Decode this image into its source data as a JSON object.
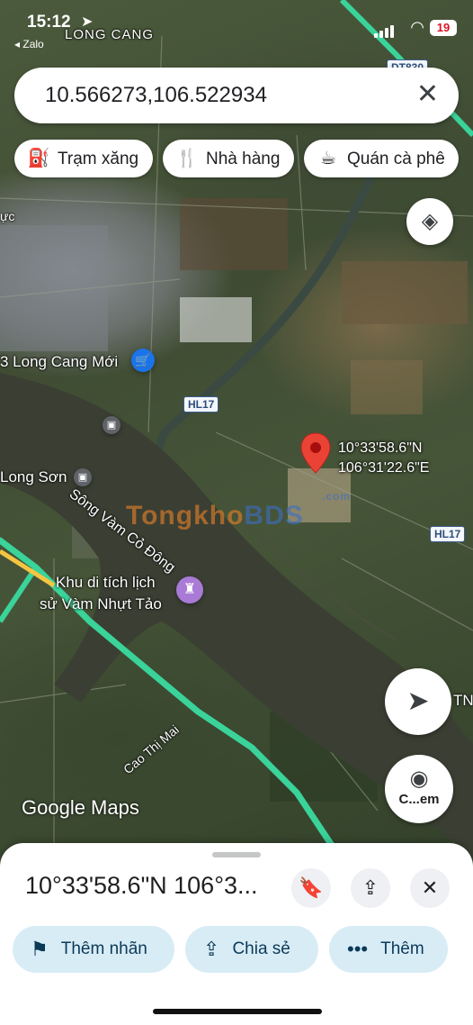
{
  "status_bar": {
    "time": "15:12",
    "back_app": "◂ Zalo",
    "battery": "19"
  },
  "search": {
    "query": "10.566273,106.522934"
  },
  "chips": [
    {
      "icon": "gas-station-icon",
      "label": "Trạm xăng"
    },
    {
      "icon": "restaurant-icon",
      "label": "Nhà hàng"
    },
    {
      "icon": "coffee-icon",
      "label": "Quán cà phê"
    }
  ],
  "map": {
    "labels": {
      "long_cang": "LONG CANG",
      "long_cang_moi": "3 Long Cang Mới",
      "long_son": "Long Sơn",
      "river": "Sông Vàm Cỏ Đông",
      "cao_thi_mai": "Cao Thị Mai",
      "khu_di_tich_1": "Khu di tích lịch",
      "khu_di_tich_2": "sử Vàm Nhựt Tảo",
      "edge_text": "TN",
      "road_top": "DT830",
      "road_hl17_a": "HL17",
      "road_hl17_b": "HL17",
      "street_left": "ực"
    },
    "pin": {
      "lat": "10°33'58.6\"N",
      "lng": "106°31'22.6\"E"
    },
    "watermark": {
      "part1": "Tongkho",
      "part2": "BDS",
      "suffix": ".com"
    },
    "attribution": "Google Maps",
    "camera_button_label": "C...em"
  },
  "sheet": {
    "title": "10°33'58.6\"N 106°3...",
    "actions": [
      {
        "icon": "flag-icon",
        "label": "Thêm nhãn"
      },
      {
        "icon": "share-icon",
        "label": "Chia sẻ"
      },
      {
        "icon": "more-icon",
        "label": "Thêm"
      }
    ]
  },
  "colors": {
    "accent": "#1a73e8",
    "pin": "#ea4335",
    "pill_bg": "#d8ecf6",
    "route": "#34d399"
  }
}
